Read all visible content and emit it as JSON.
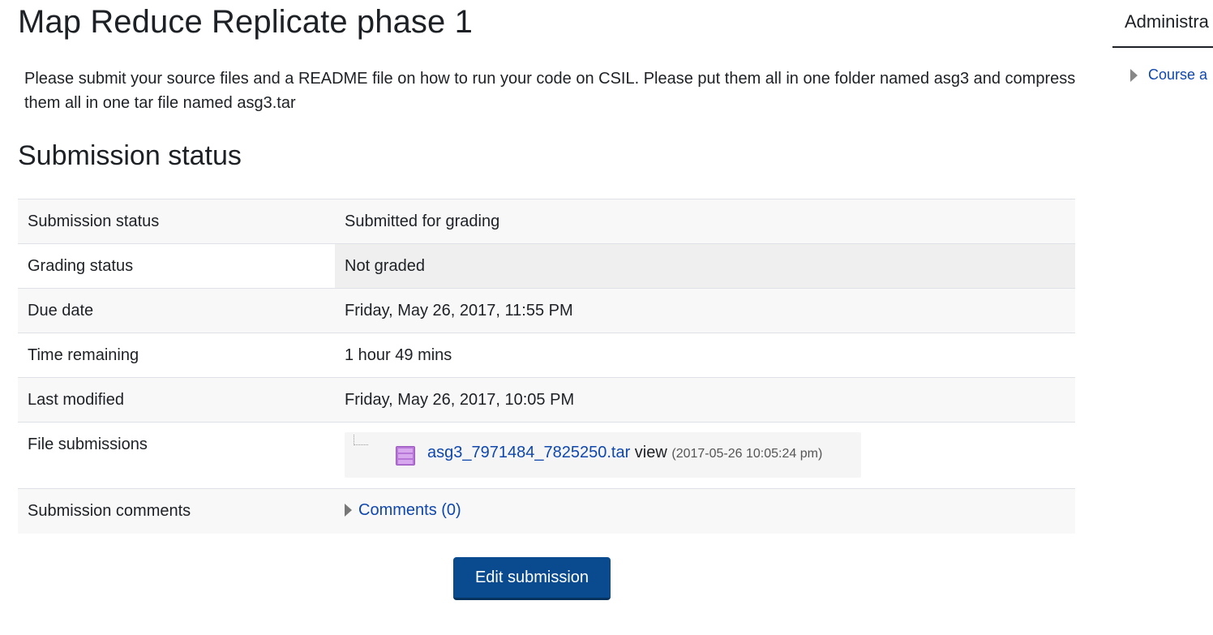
{
  "page": {
    "title": "Map Reduce Replicate phase 1",
    "intro": "Please submit your source files and a README file on how to run your code on CSIL. Please put them all in one folder named asg3 and compress them all in one tar file named asg3.tar"
  },
  "submission": {
    "section_title": "Submission status",
    "rows": {
      "status": {
        "label": "Submission status",
        "value": "Submitted for grading"
      },
      "grading": {
        "label": "Grading status",
        "value": "Not graded"
      },
      "due": {
        "label": "Due date",
        "value": "Friday, May 26, 2017, 11:55 PM"
      },
      "remaining": {
        "label": "Time remaining",
        "value": "1 hour 49 mins"
      },
      "modified": {
        "label": "Last modified",
        "value": "Friday, May 26, 2017, 10:05 PM"
      },
      "files": {
        "label": "File submissions",
        "file_name": "asg3_7971484_7825250.tar",
        "view_label": "view",
        "timestamp": "(2017-05-26 10:05:24 pm)",
        "icon": "archive-file-icon"
      },
      "comments": {
        "label": "Submission comments",
        "link": "Comments (0)"
      }
    },
    "edit_button": "Edit submission"
  },
  "admin_block": {
    "title": "Administra",
    "item": "Course a"
  },
  "colors": {
    "link": "#0f47ad",
    "primary_button": "#0a4b8f",
    "row_stripe": "#f8f8f8",
    "grading_highlight": "#efefef",
    "file_icon": "#b777d6"
  }
}
